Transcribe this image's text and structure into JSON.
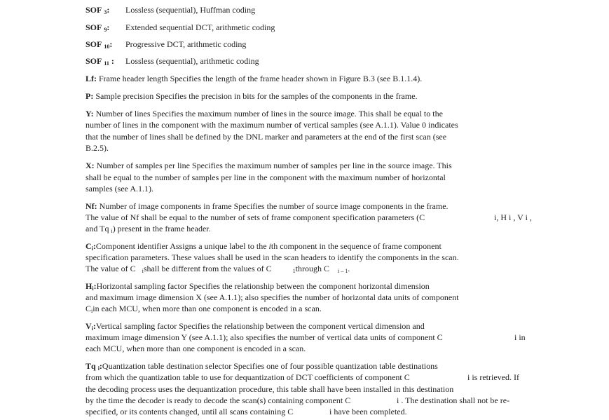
{
  "sof_entries": [
    {
      "label": "SOF",
      "sub": "3",
      "colon": ":",
      "desc": "Lossless (sequential), Huffman coding"
    },
    {
      "label": "SOF",
      "sub": "9",
      "colon": ":",
      "desc": "Extended sequential DCT, arithmetic coding"
    },
    {
      "label": "SOF",
      "sub": "10",
      "colon": ":",
      "desc": "Progressive DCT, arithmetic coding"
    },
    {
      "label": "SOF",
      "sub": "11",
      "colon": " :",
      "desc": "Lossless (sequential), arithmetic coding"
    }
  ],
  "lf": {
    "term": "Lf:",
    "text": " Frame header length  Specifies the length of the frame header shown in Figure B.3 (see B.1.1.4)."
  },
  "p": {
    "term": "P:",
    "text": " Sample precision  Specifies the precision in bits for the samples of the components in the frame."
  },
  "y": {
    "term": "Y:",
    "lines": [
      " Number of lines  Specifies the maximum number of lines in the source image. This shall be equal to the",
      "number of lines in the component with the maximum number of vertical samples (see A.1.1). Value 0 indicates",
      "that the number of lines shall be defined by the DNL marker and parameters at the end of the first scan (see",
      "B.2.5)."
    ]
  },
  "x": {
    "term": "X:",
    "lines": [
      " Number of samples per line  Specifies the maximum number of samples per line in the source image. This",
      "shall be equal to the number of samples per line in the component with the maximum number of horizontal",
      "samples (see A.1.1)."
    ]
  },
  "nf": {
    "term": "Nf:",
    "line1": " Number of image components in frame  Specifies the number of source image components in the frame.",
    "line2": "The value of Nf shall be equal to the number of sets of frame component specification parameters (C",
    "line2_right": "i, H i , V i ,",
    "line3a": "and Tq",
    "line3_sub": "i",
    "line3b": ") present in the frame header."
  },
  "c": {
    "term": "C",
    "term_sub": "i",
    "colon": ":",
    "line1": "Component identifier  Assigns a unique label to the ",
    "line1_ith": "i",
    "line1b": "th component in the sequence of frame component",
    "line2": "specification parameters. These values shall be used in the scan headers to identify the components in the scan.",
    "line3a": "The value of C",
    "line3_sub1": "i",
    "line3b": "shall be different from the values of C",
    "line3_sub2": "1",
    "line3c": "through C",
    "line3_sub3": "i – 1",
    "line3d": "."
  },
  "h": {
    "term": "H",
    "term_sub": "i",
    "colon": ":",
    "line1": "Horizontal sampling factor  Specifies the relationship between the component horizontal dimension",
    "line2": "and maximum image dimension X (see A.1.1); also specifies the number of horizontal data units of component",
    "line3a": "C",
    "line3_sub": "i",
    "line3b": "in each MCU, when more than one component is encoded in a scan."
  },
  "v": {
    "term": "V",
    "term_sub": "i",
    "colon": ":",
    "line1": "Vertical sampling factor  Specifies the relationship between the component vertical dimension and",
    "line2": "maximum image dimension Y (see A.1.1); also specifies the number of vertical data units of component C",
    "line2_right": "i in",
    "line3": "each MCU, when more than one component is encoded in a scan."
  },
  "tq": {
    "term": "Tq",
    "term_sub": "i",
    "colon": ":",
    "line1": "Quantization table destination selector  Specifies one of four possible quantization table destinations",
    "line2": "from which the quantization table to use for dequantization of DCT coefficients of component C",
    "line2_right": "i is retrieved. If",
    "line3": "the decoding process uses the dequantization procedure, this table shall have been installed in this destination",
    "line4": "by the time the decoder is ready to decode the scan(s) containing component C",
    "line4_right": "i . The destination shall not be re-",
    "line5": "specified, or its contents changed, until all scans containing C",
    "line5_right": "i have been completed."
  }
}
